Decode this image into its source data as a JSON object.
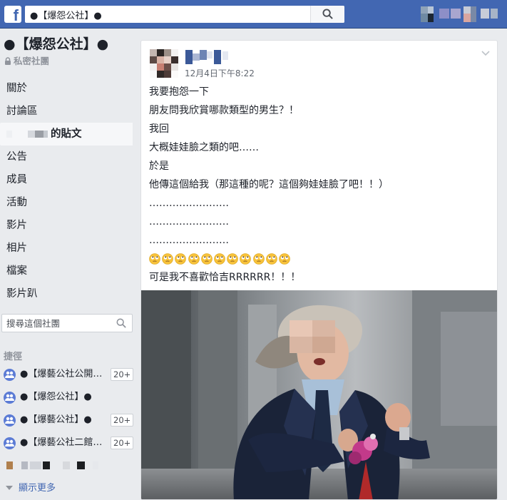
{
  "topbar": {
    "logo": "f",
    "search_value": "●【爆怨公社】●",
    "search_icon": "search-icon"
  },
  "group": {
    "title": "●【爆怨公社】●",
    "privacy": "私密社團"
  },
  "nav": {
    "items": [
      {
        "label": "關於"
      },
      {
        "label": "討論區"
      },
      {
        "label": "的貼文",
        "active": true
      },
      {
        "label": "公告"
      },
      {
        "label": "成員"
      },
      {
        "label": "活動"
      },
      {
        "label": "影片"
      },
      {
        "label": "相片"
      },
      {
        "label": "檔案"
      },
      {
        "label": "影片趴"
      }
    ]
  },
  "side_search": {
    "placeholder": "搜尋這個社團"
  },
  "shortcuts": {
    "label": "捷徑",
    "items": [
      {
        "label": "●【爆藝公社公開…",
        "badge": "20+"
      },
      {
        "label": "●【爆怨公社】●",
        "badge": ""
      },
      {
        "label": "●【爆藝公社】●",
        "badge": "20+"
      },
      {
        "label": "●【爆藝公社二館…",
        "badge": "20+"
      }
    ],
    "show_more": "顯示更多"
  },
  "post": {
    "time": "12月4日下午8:22",
    "lines": [
      "我要抱怨一下",
      "朋友問我欣賞哪款類型的男生？！",
      "我回",
      "大概娃娃臉之類的吧……",
      "於是",
      "他傳這個給我（那這種的呢？這個夠娃娃臉了吧！！）",
      "……………………",
      "……………………",
      "……………………"
    ],
    "emoji_count": 11,
    "emoji_name": "rolling-eyes-emoji",
    "last_line": "可是我不喜歡恰吉RRRRRR！！！"
  },
  "colors": {
    "brand": "#4267b2",
    "link": "#4267b2",
    "page_bg": "#e9ebee"
  }
}
